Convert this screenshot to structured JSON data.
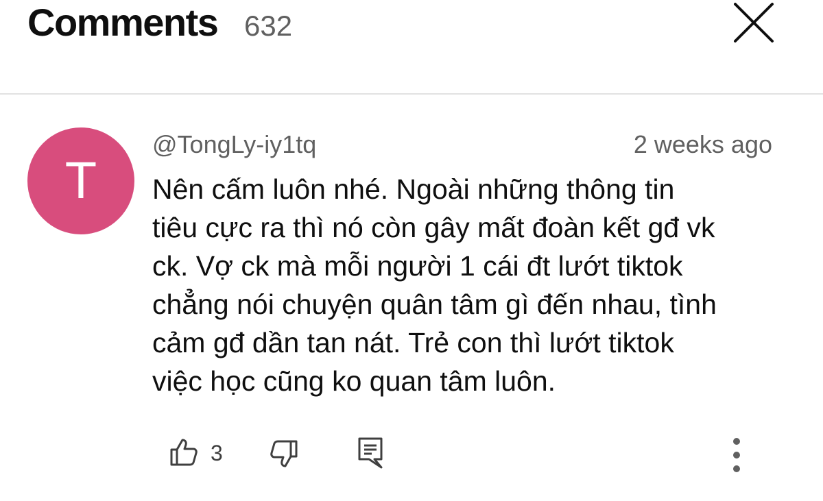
{
  "header": {
    "title": "Comments",
    "count": "632",
    "close_icon": "close-icon"
  },
  "comment": {
    "avatar_letter": "T",
    "avatar_color": "#d84d7d",
    "handle": "@TongLy-iy1tq",
    "timestamp": "2 weeks ago",
    "text_lines": [
      "Nên cấm luôn nhé. Ngoài những thông tin",
      "tiêu cực ra thì nó còn gây mất đoàn kết gđ vk",
      "ck. Vợ ck mà mỗi người 1 cái đt lướt tiktok",
      "chẳng nói chuyện quân tâm gì đến nhau, tình",
      "cảm gđ dần tan nát. Trẻ con thì lướt tiktok",
      "việc học cũng ko quan tâm luôn."
    ],
    "like_count": "3",
    "icons": {
      "like": "thumbs-up-icon",
      "dislike": "thumbs-down-icon",
      "reply": "reply-comment-icon",
      "more": "more-vertical-icon"
    }
  }
}
